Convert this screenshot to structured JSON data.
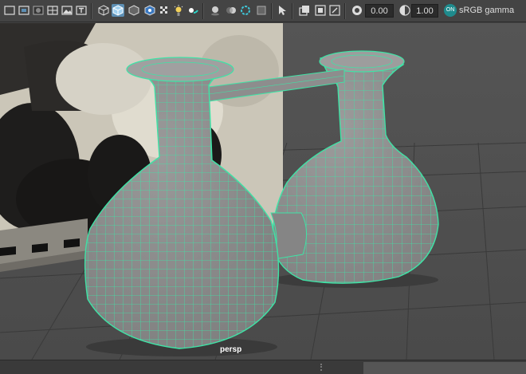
{
  "toolbar": {
    "buttons": [
      {
        "name": "wireframe-shade-icon",
        "active": false
      },
      {
        "name": "smooth-shade-icon",
        "active": false
      },
      {
        "name": "default-material-icon",
        "active": false
      },
      {
        "name": "isolate-select-icon",
        "active": false
      },
      {
        "name": "textured-icon",
        "active": false
      },
      {
        "name": "text-t-icon",
        "active": false
      },
      {
        "name": "xray-icon",
        "active": false
      },
      {
        "name": "xray-active-icon",
        "active": true
      },
      {
        "name": "xray-joints-icon",
        "active": false
      },
      {
        "name": "checker-icon",
        "active": false
      },
      {
        "name": "lights-icon",
        "active": false
      },
      {
        "name": "shadows-icon",
        "active": false
      },
      {
        "name": "ambient-occlusion-icon",
        "active": false
      },
      {
        "name": "motion-blur-icon",
        "active": false
      },
      {
        "name": "anti-alias-icon",
        "active": false
      },
      {
        "name": "depth-of-field-icon",
        "active": false
      },
      {
        "name": "select-cursor-icon",
        "active": false
      },
      {
        "name": "camera-gate-icon",
        "active": false
      },
      {
        "name": "resolution-gate-icon",
        "active": false
      },
      {
        "name": "safe-action-icon",
        "active": false
      },
      {
        "name": "exposure-icon",
        "active": false
      },
      {
        "name": "gamma-icon",
        "active": false
      }
    ],
    "exposure_value": "0.00",
    "gamma_value": "1.00",
    "color_mgmt_badge": "ON",
    "color_space": "sRGB gamma"
  },
  "viewport": {
    "camera_label": "persp"
  },
  "colors": {
    "wire": "#3fe3a6",
    "mesh": "#8f8f8f",
    "toolbar_bg": "#444444",
    "active": "#5d8fb4"
  }
}
